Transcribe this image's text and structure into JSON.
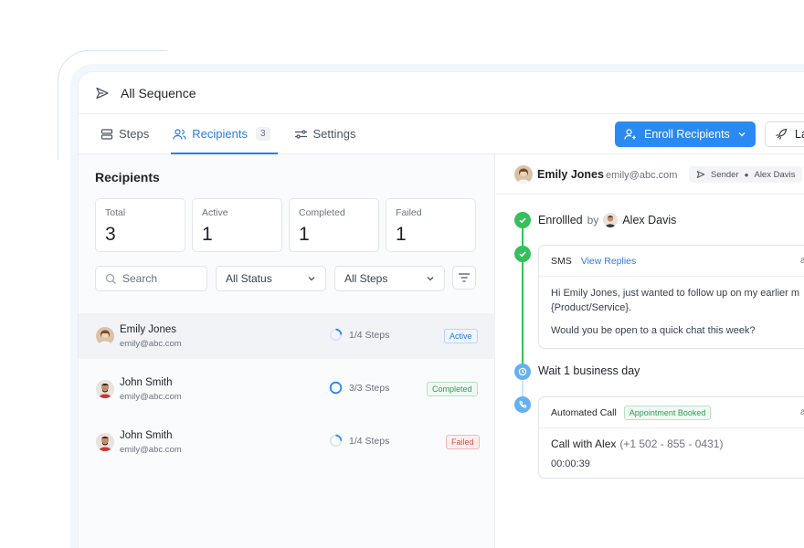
{
  "header": {
    "title": "All Sequence"
  },
  "tabs": [
    {
      "label": "Steps"
    },
    {
      "label": "Recipients",
      "count": "3"
    },
    {
      "label": "Settings"
    }
  ],
  "actions": {
    "enroll_label": "Enroll Recipients",
    "secondary_label": "La"
  },
  "recipients": {
    "title": "Recipients",
    "stats": [
      {
        "label": "Total",
        "value": "3"
      },
      {
        "label": "Active",
        "value": "1"
      },
      {
        "label": "Completed",
        "value": "1"
      },
      {
        "label": "Failed",
        "value": "1"
      }
    ],
    "search_placeholder": "Search",
    "status_filter": "All Status",
    "steps_filter": "All Steps",
    "rows": [
      {
        "name": "Emily Jones",
        "email": "emily@abc.com",
        "steps": "1/4 Steps",
        "progress": 0.25,
        "status": "Active"
      },
      {
        "name": "John Smith",
        "email": "emily@abc.com",
        "steps": "3/3 Steps",
        "progress": 1.0,
        "status": "Completed"
      },
      {
        "name": "John Smith",
        "email": "emily@abc.com",
        "steps": "1/4 Steps",
        "progress": 0.25,
        "status": "Failed"
      }
    ]
  },
  "detail": {
    "name": "Emily Jones",
    "email": "emily@abc.com",
    "sender_label": "Sender",
    "sender_name": "Alex Davis",
    "enrolled_text": "Enrollled",
    "by_text": "by",
    "enrolled_by": "Alex Davis",
    "sms": {
      "label": "SMS",
      "link": "View Replies",
      "edge": "a",
      "message_1": "Hi Emily Jones, just wanted to follow up on my earlier m {Product/Service}.",
      "message_2": "Would you be open to a quick chat this week?"
    },
    "wait_text": "Wait 1 business day",
    "call": {
      "label": "Automated Call",
      "badge": "Appointment Booked",
      "edge": "a",
      "title": "Call with Alex",
      "number": "(+1 502 - 855 - 0431)",
      "duration": "00:00:39"
    }
  },
  "colors": {
    "accent": "#2a8af2",
    "success": "#34c05a",
    "danger": "#d9534f"
  }
}
